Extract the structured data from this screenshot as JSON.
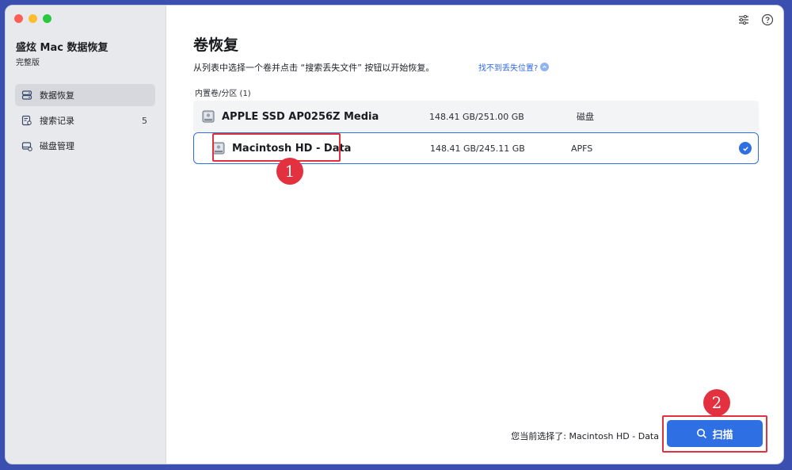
{
  "app": {
    "title": "盛炫 Mac 数据恢复",
    "edition": "完整版"
  },
  "sidebar": {
    "items": [
      {
        "label": "数据恢复",
        "icon": "data-recovery-icon",
        "active": true
      },
      {
        "label": "搜索记录",
        "icon": "search-history-icon",
        "badge": "5"
      },
      {
        "label": "磁盘管理",
        "icon": "disk-management-icon"
      }
    ]
  },
  "header": {
    "icons": [
      "settings-sliders-icon",
      "help-icon"
    ]
  },
  "main": {
    "title": "卷恢复",
    "description": "从列表中选择一个卷并点击 “搜索丢失文件” 按钮以开始恢复。",
    "help_link": "找不到丢失位置?",
    "help_link_icon": "chevron-up-icon",
    "section_label": "内置卷/分区 (1)",
    "volumes": [
      {
        "name": "APPLE SSD AP0256Z Media",
        "size": "148.41 GB/251.00 GB",
        "type": "磁盘",
        "selected": false
      },
      {
        "name": "Macintosh HD - Data",
        "size": "148.41 GB/245.11 GB",
        "type": "APFS",
        "selected": true
      }
    ]
  },
  "footer": {
    "selected_text": "您当前选择了: Macintosh HD - Data",
    "scan_label": "扫描"
  },
  "annotations": {
    "first": "1",
    "second": "2",
    "color": "#e3313f"
  },
  "colors": {
    "accent": "#2f6fe4",
    "sidebar_bg": "#e8e9ec",
    "frame": "#3a4fb0"
  }
}
